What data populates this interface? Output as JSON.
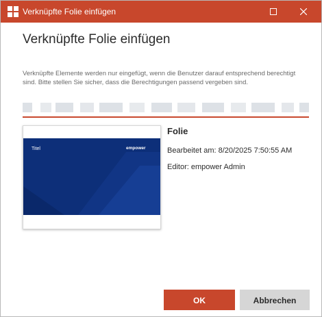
{
  "titlebar": {
    "title": "Verknüpfte Folie einfügen",
    "icon": "powerpoint-app-icon",
    "maximize_icon": "maximize-icon",
    "close_icon": "close-icon"
  },
  "dialog": {
    "heading": "Verknüpfte Folie einfügen",
    "info_text": "Verknüpfte Elemente werden nur eingefügt, wenn die Benutzer darauf entsprechend berechtigt sind. Bitte stellen Sie sicher, dass die Berechtigungen passend vergeben sind."
  },
  "slide_preview": {
    "slide_title": "Titel",
    "logo_text": "empower"
  },
  "details": {
    "name": "Folie",
    "edited": "Bearbeitet am: 8/20/2025 7:50:55 AM",
    "editor": "Editor: empower Admin"
  },
  "buttons": {
    "ok": "OK",
    "cancel": "Abbrechen"
  },
  "colors": {
    "accent": "#c8472c",
    "slide_background": "#0d2f79",
    "secondary_button": "#d6d6d6"
  }
}
